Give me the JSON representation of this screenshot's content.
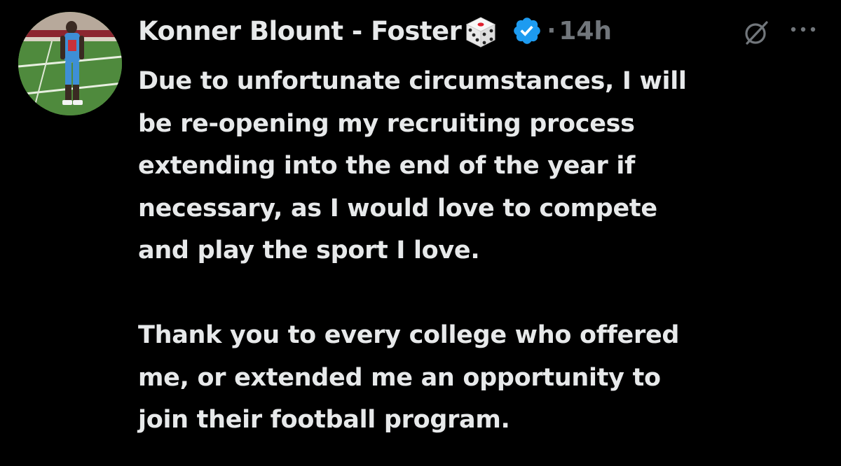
{
  "tweet": {
    "author": {
      "display_name": "Konner Blount - Foster",
      "name_emoji_icon": "die-icon",
      "verified_icon": "verified-badge-icon",
      "verified_color": "#1d9bf0"
    },
    "separator": "·",
    "timestamp": "14h",
    "actions": {
      "grok_icon": "grok-icon",
      "more_icon": "more-options-icon"
    },
    "text": {
      "lines": [
        "Due to unfortunate circumstances, I will",
        "be re-opening my recruiting process",
        "extending into the end of the year if",
        "necessary, as I would love to compete",
        "and play the sport I love.",
        "",
        "Thank you to every college who offered",
        "me, or extended me an opportunity to",
        "join their football program."
      ]
    }
  },
  "colors": {
    "background": "#000000",
    "text_primary": "#e7e9ea",
    "text_secondary": "#71767b",
    "accent": "#1d9bf0"
  }
}
